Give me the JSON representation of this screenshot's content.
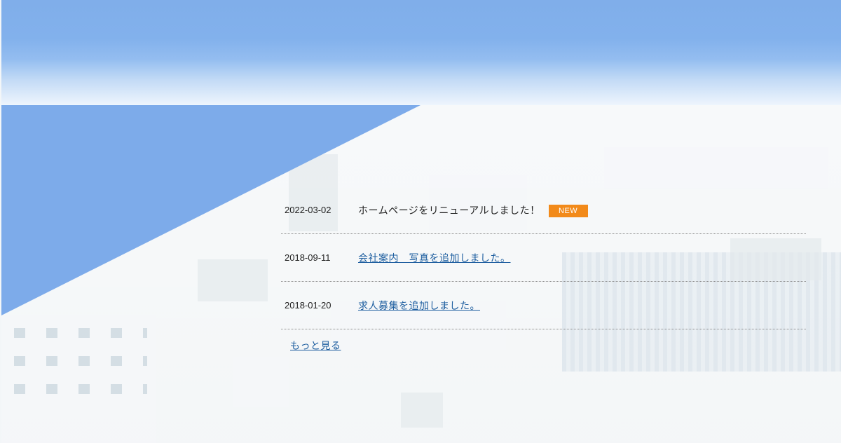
{
  "news": {
    "items": [
      {
        "date": "2022-03-02",
        "title": "ホームページをリニューアルしました！",
        "badge": "NEW"
      },
      {
        "date": "2018-09-11",
        "title": "会社案内　写真を追加しました。"
      },
      {
        "date": "2018-01-20",
        "title": "求人募集を追加しました。"
      }
    ],
    "more_label": "もっと見る"
  },
  "colors": {
    "accent_blue": "#7dabea",
    "badge_orange": "#f28a1a",
    "link": "#1f5fa0"
  }
}
